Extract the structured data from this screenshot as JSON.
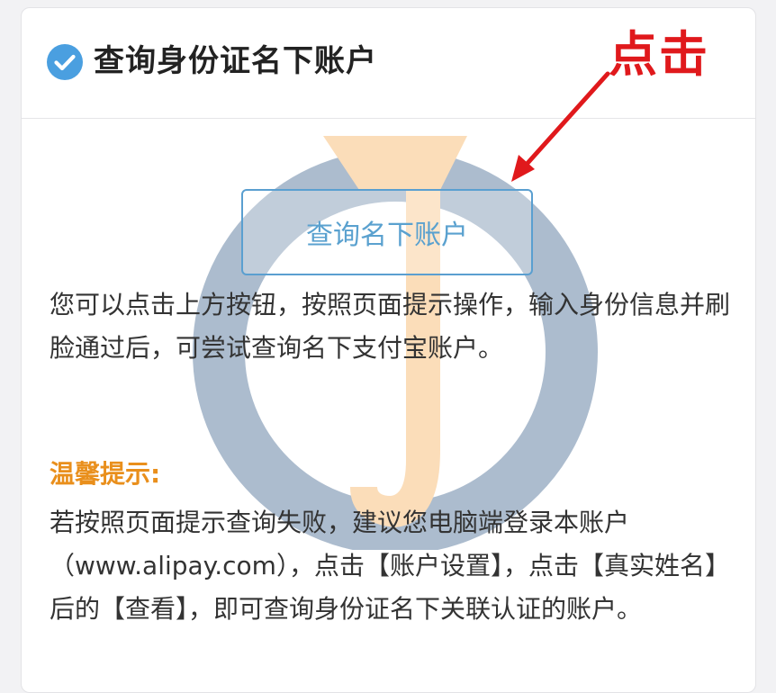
{
  "header": {
    "title": "查询身份证名下账户",
    "icon": "check-circle-icon",
    "icon_color": "#4a9fe0"
  },
  "annotation": {
    "text": "点击",
    "color": "#e0191c"
  },
  "main": {
    "button_label": "查询名下账户",
    "description": "您可以点击上方按钮，按照页面提示操作，输入身份信息并刷脸通过后，可尝试查询名下支付宝账户。",
    "tip_title": "温馨提示:",
    "tip_body": "若按照页面提示查询失败，建议您电脑端登录本账户（www.alipay.com），点击【账户设置】，点击【真实姓名】后的【查看】，即可查询身份证名下关联认证的账户。"
  },
  "colors": {
    "button_border": "#5a9fd0",
    "button_text": "#5aa1cf",
    "tip_title": "#e98f1c"
  }
}
